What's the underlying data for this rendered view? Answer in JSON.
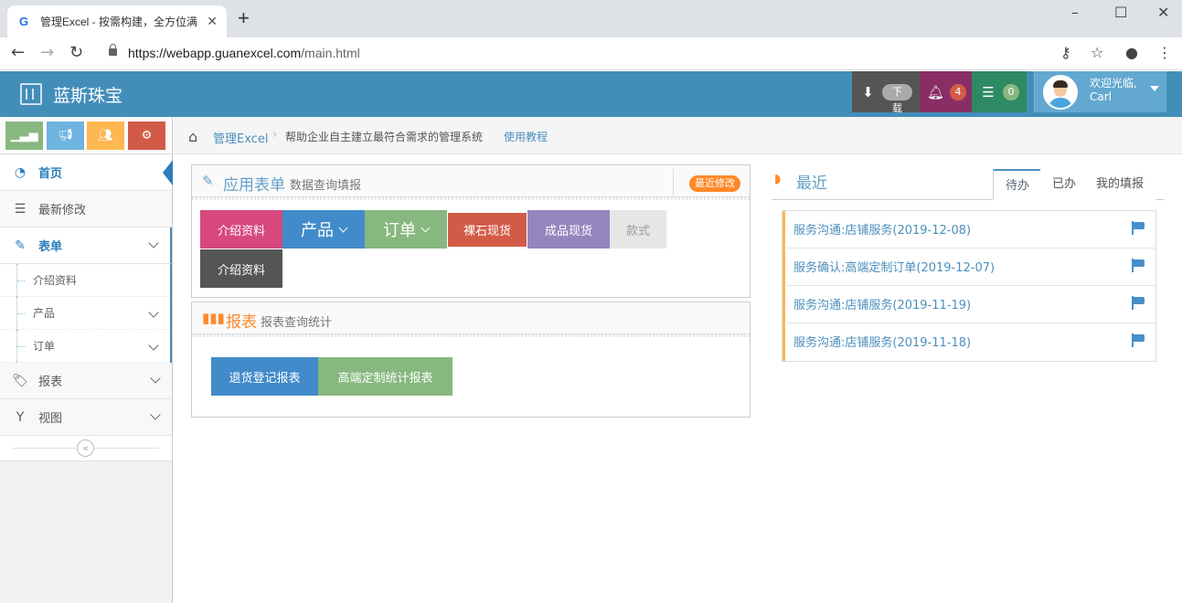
{
  "browser": {
    "tab_title": "管理Excel - 按需构建，全方位满",
    "favicon_letter": "G",
    "url_scheme": "https://",
    "url_host": "webapp.guanexcel.com",
    "url_path": "/main.html"
  },
  "header": {
    "brand": "蓝斯珠宝",
    "download_label": "下载",
    "notifications_count": "4",
    "messages_count": "0",
    "user_greeting": "欢迎光临,",
    "user_name": "Carl",
    "colors": {
      "header": "#438eb9",
      "download": "#555555",
      "bell": "#892e65",
      "msg": "#2e8965"
    }
  },
  "sidebar": {
    "shortcut_colors": [
      "#87b87f",
      "#6fb3e0",
      "#ffb752",
      "#d15b47"
    ],
    "items": [
      {
        "label": "首页",
        "icon": "dashboard-icon"
      },
      {
        "label": "最新修改",
        "icon": "list-icon"
      },
      {
        "label": "表单",
        "icon": "edit-icon"
      },
      {
        "label": "报表",
        "icon": "tag-icon"
      },
      {
        "label": "视图",
        "icon": "filter-icon"
      }
    ],
    "form_subitems": [
      "介绍资料",
      "产品",
      "订单"
    ]
  },
  "breadcrumb": {
    "link": "管理Excel",
    "description": "帮助企业自主建立最符合需求的管理系统",
    "tutorial": "使用教程"
  },
  "forms_widget": {
    "title": "应用表单",
    "subtitle": "数据查询填报",
    "badge": "最近修改",
    "tiles": [
      {
        "label": "介绍资料",
        "color": "#d6487e"
      },
      {
        "label": "产品",
        "color": "#428bca"
      },
      {
        "label": "订单",
        "color": "#87b87f"
      },
      {
        "label": "裸石现货",
        "color": "#d15b47"
      },
      {
        "label": "成品现货",
        "color": "#9585bf"
      },
      {
        "label": "款式",
        "color": "#e7e7e7"
      },
      {
        "label": "介绍资料",
        "color": "#555555"
      }
    ]
  },
  "reports_widget": {
    "title": "报表",
    "subtitle": "报表查询统计",
    "tiles": [
      {
        "label": "退货登记报表",
        "color": "#428bca"
      },
      {
        "label": "高端定制统计报表",
        "color": "#87b87f"
      }
    ]
  },
  "recent": {
    "title": "最近",
    "tabs": [
      "待办",
      "已办",
      "我的填报"
    ],
    "items": [
      "服务沟通:店铺服务(2019-12-08)",
      "服务确认:高端定制订单(2019-12-07)",
      "服务沟通:店铺服务(2019-11-19)",
      "服务沟通:店铺服务(2019-11-18)"
    ]
  }
}
